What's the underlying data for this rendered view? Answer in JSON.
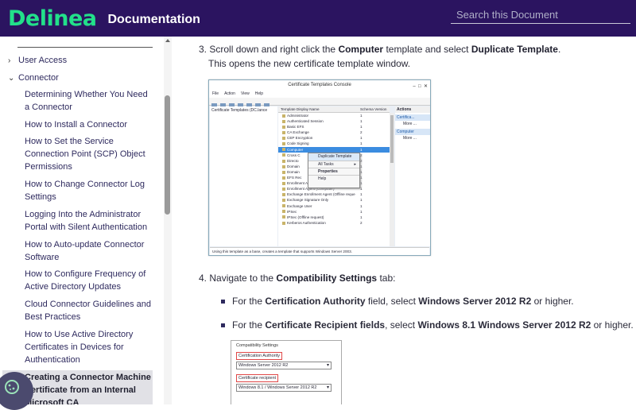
{
  "header": {
    "logo": "Delinea",
    "title": "Documentation",
    "search_placeholder": "Search this Document"
  },
  "sidebar": {
    "top_items": [
      {
        "label": "User Access",
        "chevron": "›"
      },
      {
        "label": "Connector",
        "chevron": "⌄"
      }
    ],
    "items": [
      "Determining Whether You Need a Connector",
      "How to Install a Connector",
      "How to Set the Service Connection Point (SCP) Object Permissions",
      "How to Change Connector Log Settings",
      "Logging Into the Administrator Portal with Silent Authentication",
      "How to Auto-update Connector Software",
      "How to Configure Frequency of Active Directory Updates",
      "Cloud Connector Guidelines and Best Practices",
      "How to Use Active Directory Certificates in Devices for Authentication"
    ],
    "active_item": "Creating a Connector Machine Certificate from an Internal Microsoft CA"
  },
  "content": {
    "step3": {
      "num": "3.",
      "a": "Scroll down and right click the ",
      "b": "Computer",
      "c": " template and select ",
      "d": "Duplicate Template",
      "e": ".",
      "line2": "This opens the new certificate template window."
    },
    "step4": {
      "num": "4.",
      "a": "Navigate to the ",
      "b": "Compatibility Settings",
      "c": " tab:"
    },
    "bullet1": {
      "a": "For the ",
      "b": "Certification Authority",
      "c": " field, select ",
      "d": "Windows Server 2012 R2",
      "e": " or higher."
    },
    "bullet2": {
      "a": "For the ",
      "b": "Certificate Recipient fields",
      "c": ", select ",
      "d": "Windows 8.1 Windows Server 2012 R2",
      "e": " or higher."
    }
  },
  "shot1": {
    "window_title": "Certificate Templates Console",
    "menu": [
      "File",
      "Action",
      "View",
      "Help"
    ],
    "tree_item": "Certificate Templates (DC.lance",
    "col_name": "Template Display Name",
    "col_version": "Schema Version",
    "rows": [
      {
        "name": "Administrator",
        "v": "1"
      },
      {
        "name": "Authenticated Session",
        "v": "1"
      },
      {
        "name": "Basic EFS",
        "v": "1"
      },
      {
        "name": "CA Exchange",
        "v": "2"
      },
      {
        "name": "CEP Encryption",
        "v": "1"
      },
      {
        "name": "Code Signing",
        "v": "1"
      },
      {
        "name": "Computer",
        "v": "1"
      },
      {
        "name": "Cross C",
        "v": "2"
      },
      {
        "name": "Directo",
        "v": "2"
      },
      {
        "name": "Domain",
        "v": "1"
      },
      {
        "name": "Domain",
        "v": "1"
      },
      {
        "name": "EFS Rec",
        "v": "1"
      },
      {
        "name": "Enrollment Agent",
        "v": "1"
      },
      {
        "name": "Enrollment Agent (Computer)",
        "v": "1"
      },
      {
        "name": "Exchange Enrollment Agent (Offline reque",
        "v": "1"
      },
      {
        "name": "Exchange Signature Only",
        "v": "1"
      },
      {
        "name": "Exchange User",
        "v": "1"
      },
      {
        "name": "IPSec",
        "v": "1"
      },
      {
        "name": "IPSec (Offline request)",
        "v": "1"
      },
      {
        "name": "Kerberos Authentication",
        "v": "2"
      }
    ],
    "context_menu": [
      "Duplicate Template",
      "All Tasks",
      "Properties",
      "Help"
    ],
    "actions_title": "Actions",
    "actions": [
      {
        "head": "Certifica...",
        "more": "More ..."
      },
      {
        "head": "Computer",
        "more": "More ..."
      }
    ],
    "status": "Using this template as a base, creates a template that supports Windows Server 2003."
  },
  "shot2": {
    "title": "Compatibility Settings",
    "label1": "Certification Authority",
    "value1": "Windows Server 2012 R2",
    "label2": "Certificate recipient",
    "value2": "Windows 8.1 / Windows Server 2012 R2"
  }
}
